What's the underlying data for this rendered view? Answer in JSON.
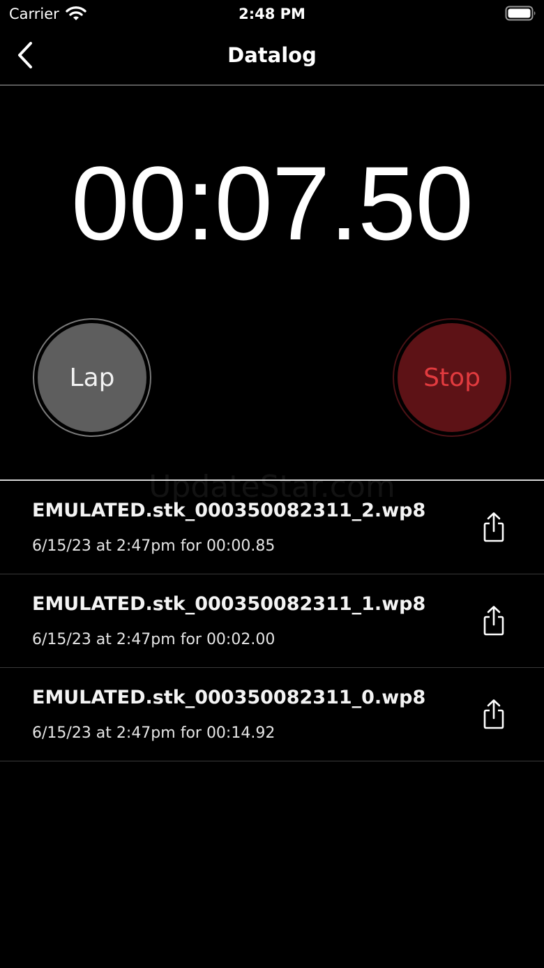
{
  "status_bar": {
    "carrier": "Carrier",
    "time": "2:48 PM"
  },
  "nav": {
    "title": "Datalog"
  },
  "timer": {
    "value": "00:07.50"
  },
  "buttons": {
    "lap_label": "Lap",
    "stop_label": "Stop"
  },
  "watermark": "UpdateStar.com",
  "log_items": [
    {
      "name": "EMULATED.stk_000350082311_2.wp8",
      "meta": "6/15/23 at 2:47pm for 00:00.85"
    },
    {
      "name": "EMULATED.stk_000350082311_1.wp8",
      "meta": "6/15/23 at 2:47pm for 00:02.00"
    },
    {
      "name": "EMULATED.stk_000350082311_0.wp8",
      "meta": "6/15/23 at 2:47pm for 00:14.92"
    }
  ],
  "colors": {
    "background": "#000000",
    "lap_button": "#5e5e5e",
    "stop_button": "#5d1216",
    "stop_text": "#e23b3f"
  },
  "icons": {
    "wifi": "wifi-icon",
    "battery": "battery-icon",
    "back": "chevron-left-icon",
    "share": "share-icon"
  }
}
